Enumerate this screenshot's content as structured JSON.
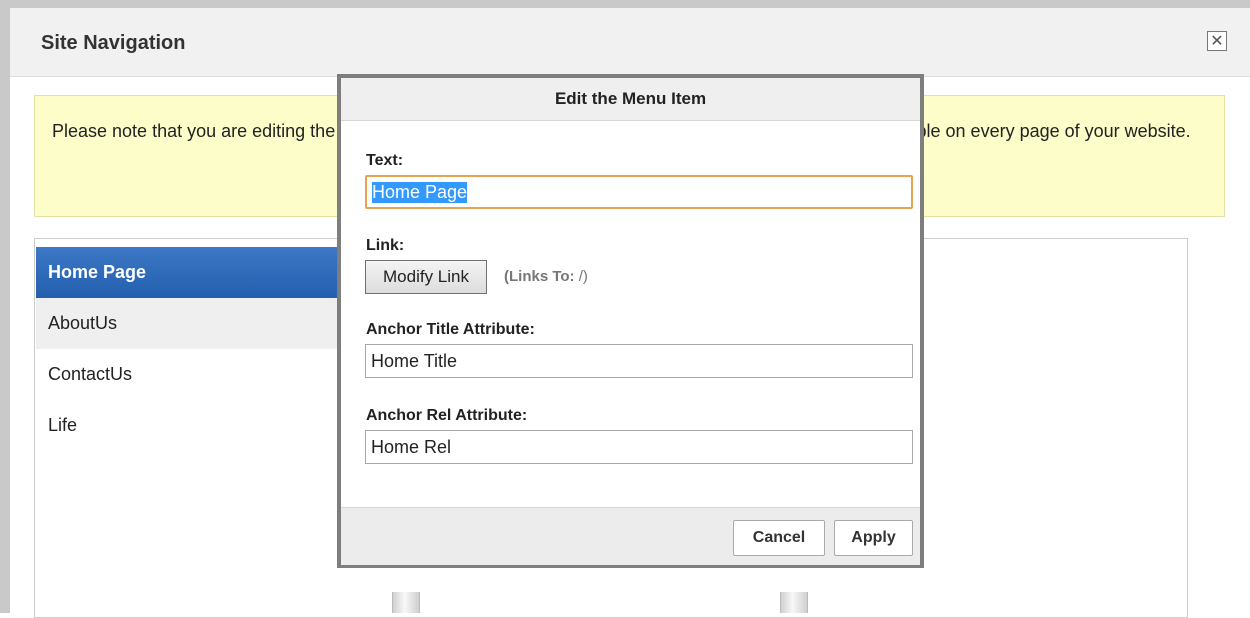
{
  "site_nav": {
    "title": "Site Navigation",
    "close_symbol": "✕",
    "notice": "Please note that you are editing the navigation menu for your entire site. Any changes made here, will be visible on every page of your website.",
    "menu_items": [
      {
        "label": "Home Page",
        "state": "selected"
      },
      {
        "label": "AboutUs",
        "state": "hover"
      },
      {
        "label": "ContactUs",
        "state": "normal"
      },
      {
        "label": "Life",
        "state": "normal"
      }
    ]
  },
  "dialog": {
    "title": "Edit the Menu Item",
    "text_label": "Text:",
    "text_value": "Home Page",
    "link_label": "Link:",
    "modify_link_button": "Modify Link",
    "links_to_label": "(Links To:",
    "links_to_value": "/)",
    "anchor_title_label": "Anchor Title Attribute:",
    "anchor_title_value": "Home Title",
    "anchor_rel_label": "Anchor Rel Attribute:",
    "anchor_rel_value": "Home Rel",
    "cancel_button": "Cancel",
    "apply_button": "Apply"
  },
  "colors": {
    "selected_item": "#2d6bbd",
    "notice_background": "#fdfdc9",
    "input_focus_border": "#e5a54e",
    "modal_border": "#7e7e7e"
  },
  "icons": {
    "close": "close-icon"
  }
}
